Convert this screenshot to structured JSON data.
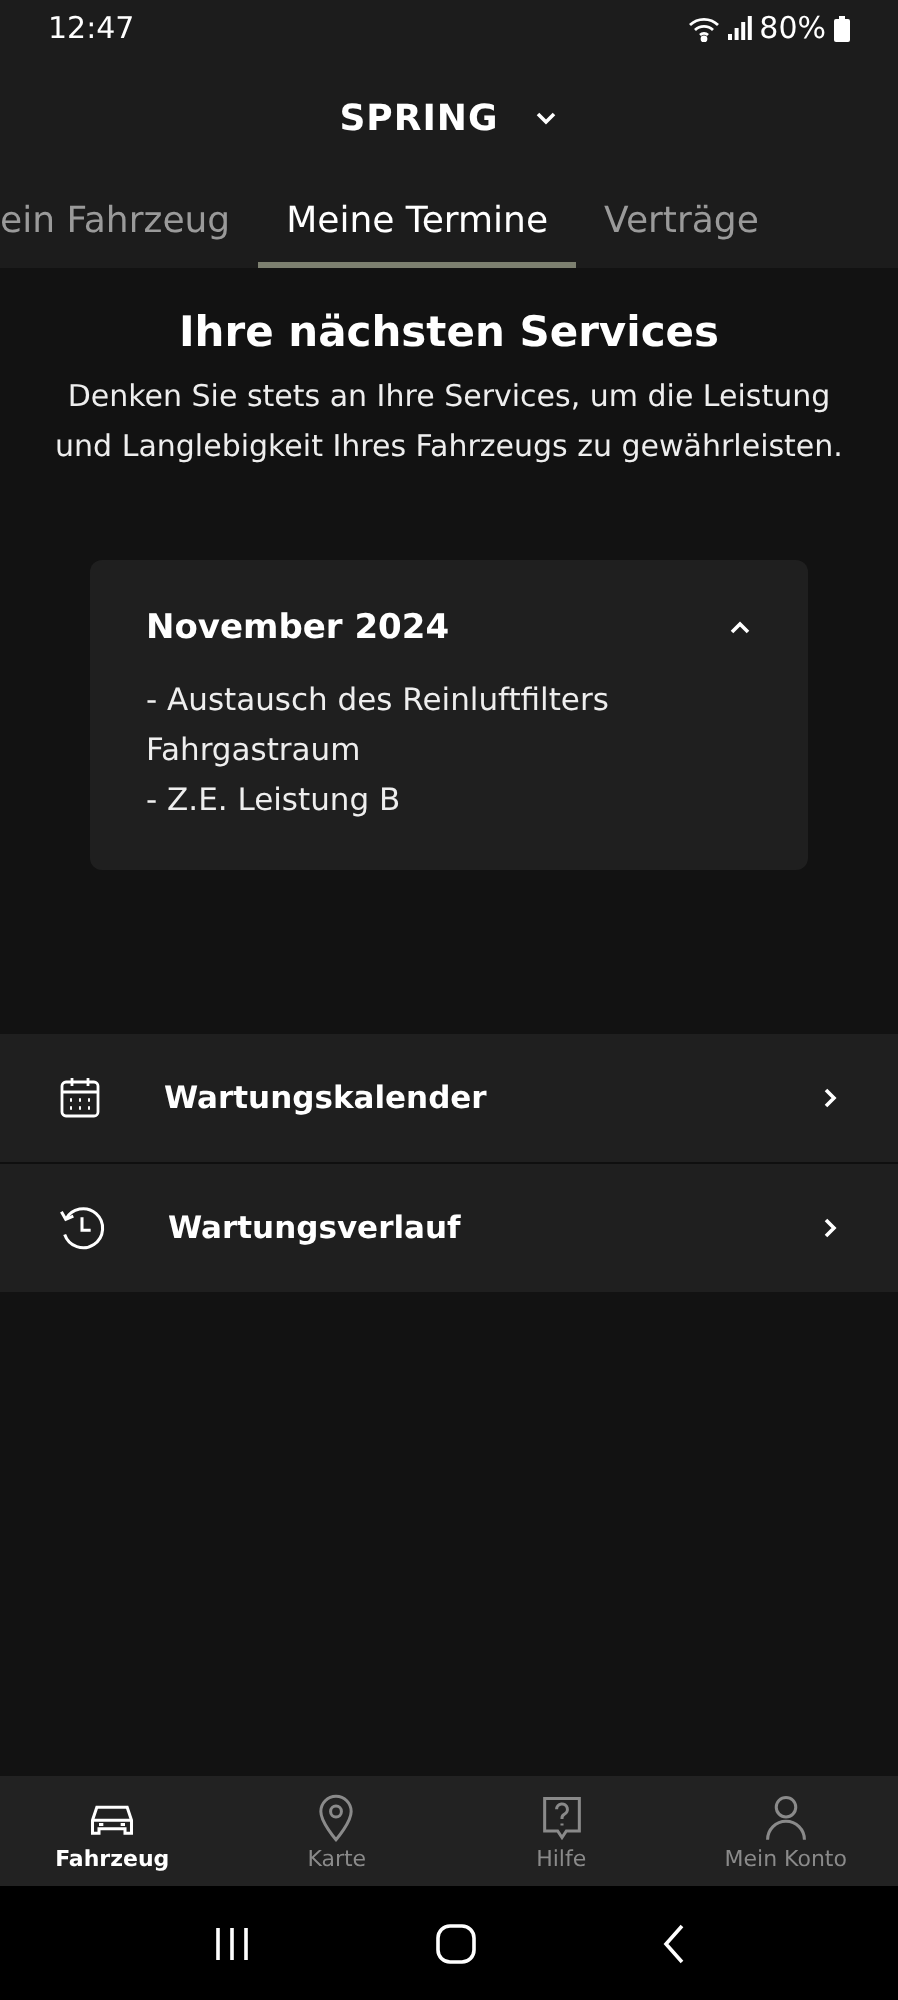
{
  "status_bar": {
    "time": "12:47",
    "battery": "80%"
  },
  "header": {
    "title": "SPRING"
  },
  "tabs": [
    {
      "label": "ein Fahrzeug",
      "selected": false
    },
    {
      "label": "Meine Termine",
      "selected": true
    },
    {
      "label": "Verträge",
      "selected": false
    }
  ],
  "intro": {
    "title": "Ihre nächsten Services",
    "text": "Denken Sie stets an Ihre Services, um die Leistung und Langlebigkeit Ihres Fahrzeugs zu gewährleisten."
  },
  "service_card": {
    "title": "November 2024",
    "expanded": true,
    "lines": [
      "- Austausch des Reinluftfilters Fahrgastraum",
      "- Z.E. Leistung B"
    ]
  },
  "menu": [
    {
      "kind": "calendar",
      "label": "Wartungskalender"
    },
    {
      "kind": "history",
      "label": "Wartungsverlauf"
    }
  ],
  "bottom_nav": [
    {
      "kind": "car",
      "label": "Fahrzeug",
      "selected": true
    },
    {
      "kind": "pin",
      "label": "Karte",
      "selected": false
    },
    {
      "kind": "help",
      "label": "Hilfe",
      "selected": false
    },
    {
      "kind": "person",
      "label": "Mein Konto",
      "selected": false
    }
  ]
}
